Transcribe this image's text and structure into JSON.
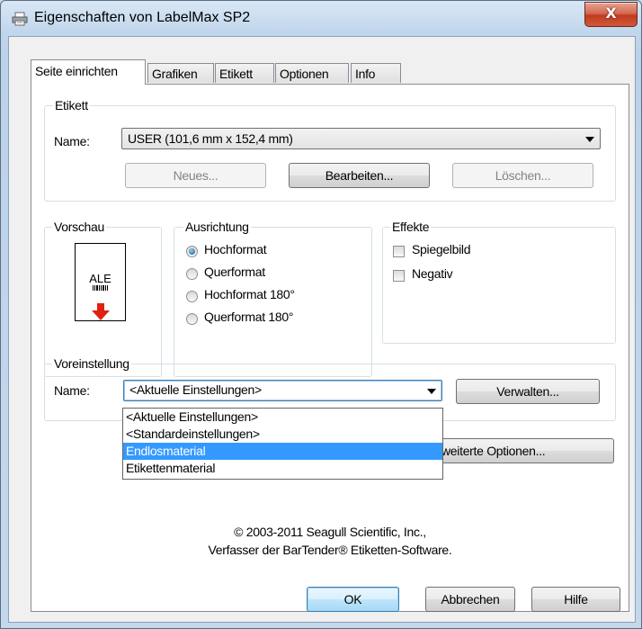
{
  "window": {
    "title": "Eigenschaften von LabelMax SP2",
    "close_glyph": "X"
  },
  "tabs": [
    {
      "label": "Seite einrichten",
      "active": true
    },
    {
      "label": "Grafiken",
      "active": false
    },
    {
      "label": "Etikett",
      "active": false
    },
    {
      "label": "Optionen",
      "active": false
    },
    {
      "label": "Info",
      "active": false
    }
  ],
  "etikett": {
    "group_label": "Etikett",
    "name_label": "Name:",
    "name_value": "USER (101,6 mm x 152,4 mm)",
    "new_button": "Neues...",
    "edit_button": "Bearbeiten...",
    "delete_button": "Löschen..."
  },
  "vorschau": {
    "group_label": "Vorschau",
    "preview_text": "ALE"
  },
  "ausrichtung": {
    "group_label": "Ausrichtung",
    "options": [
      {
        "label": "Hochformat",
        "selected": true
      },
      {
        "label": "Querformat",
        "selected": false
      },
      {
        "label": "Hochformat 180°",
        "selected": false
      },
      {
        "label": "Querformat 180°",
        "selected": false
      }
    ]
  },
  "effekte": {
    "group_label": "Effekte",
    "options": [
      {
        "label": "Spiegelbild",
        "checked": false
      },
      {
        "label": "Negativ",
        "checked": false
      }
    ]
  },
  "voreinstellung": {
    "group_label": "Voreinstellung",
    "name_label": "Name:",
    "name_value": "<Aktuelle Einstellungen>",
    "manage_button": "Verwalten...",
    "dropdown_items": [
      {
        "label": "<Aktuelle Einstellungen>",
        "selected": false
      },
      {
        "label": "<Standardeinstellungen>",
        "selected": false
      },
      {
        "label": "Endlosmaterial",
        "selected": true
      },
      {
        "label": "Etikettenmaterial",
        "selected": false
      }
    ]
  },
  "advanced_button": "Erweiterte Optionen...",
  "advanced_button_visible": "weiterte Optionen...",
  "footer": {
    "line1": "© 2003-2011 Seagull Scientific, Inc.,",
    "line2": "Verfasser der BarTender® Etiketten-Software."
  },
  "buttons": {
    "ok": "OK",
    "cancel": "Abbrechen",
    "help": "Hilfe"
  },
  "colors": {
    "selection": "#3399ff",
    "default_button_border": "#3c7fb1",
    "close_button": "#c13c20"
  }
}
